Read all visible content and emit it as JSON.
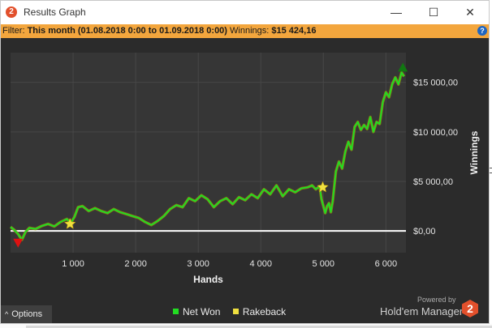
{
  "window": {
    "title": "Results Graph",
    "app_icon_glyph": "2",
    "controls": {
      "minimize": "—",
      "maximize": "☐",
      "close": "✕"
    }
  },
  "filter": {
    "label": "Filter:",
    "value": "This month (01.08.2018 0:00 to 01.09.2018 0:00)",
    "winnings_label": "Winnings:",
    "winnings_value": "$15 424,16",
    "help_icon": "?"
  },
  "options_button": {
    "caret": "^",
    "label": "Options"
  },
  "branding": {
    "powered_by": "Powered by",
    "name": "Hold'em Manager",
    "logo_glyph": "2"
  },
  "colors": {
    "net_won": "#22dd22",
    "rakeback": "#f0e040",
    "zero_line": "#ffffff",
    "filter_bar": "#f3a63d",
    "background": "#2b2b2b",
    "plot_background": "#363636",
    "gridline": "#474747",
    "min_marker": "#dd1111",
    "max_marker": "#117711"
  },
  "chart_data": {
    "type": "line",
    "xlabel": "Hands",
    "ylabel": "Winnings",
    "xlim": [
      0,
      6320
    ],
    "ylim": [
      -2200,
      18000
    ],
    "x_ticks": [
      1000,
      2000,
      3000,
      4000,
      5000,
      6000
    ],
    "x_tick_labels": [
      "1 000",
      "2 000",
      "3 000",
      "4 000",
      "5 000",
      "6 000"
    ],
    "y_ticks": [
      0,
      5000,
      10000,
      15000
    ],
    "y_tick_labels": [
      "$0,00",
      "$5 000,00",
      "$10 000,00",
      "$15 000,00"
    ],
    "grid": true,
    "legend": [
      "Net Won",
      "Rakeback"
    ],
    "legend_position": "bottom",
    "series": [
      {
        "name": "Net Won",
        "x": [
          0,
          60,
          120,
          180,
          240,
          300,
          400,
          500,
          600,
          700,
          800,
          900,
          960,
          1020,
          1080,
          1150,
          1250,
          1350,
          1450,
          1550,
          1650,
          1750,
          1850,
          1950,
          2050,
          2150,
          2250,
          2350,
          2450,
          2550,
          2650,
          2750,
          2850,
          2950,
          3050,
          3150,
          3250,
          3350,
          3450,
          3550,
          3650,
          3750,
          3850,
          3950,
          4050,
          4150,
          4250,
          4350,
          4450,
          4550,
          4650,
          4750,
          4820,
          4880,
          4940,
          4970,
          5000,
          5030,
          5060,
          5090,
          5120,
          5150,
          5200,
          5250,
          5300,
          5350,
          5400,
          5450,
          5500,
          5550,
          5600,
          5650,
          5700,
          5750,
          5800,
          5850,
          5900,
          5950,
          6000,
          6050,
          6100,
          6150,
          6200,
          6250,
          6290
        ],
        "y": [
          400,
          100,
          -300,
          -900,
          -100,
          300,
          200,
          500,
          700,
          450,
          900,
          1200,
          800,
          1400,
          2400,
          2500,
          2000,
          2300,
          2000,
          1800,
          2200,
          1900,
          1700,
          1500,
          1300,
          900,
          600,
          1000,
          1500,
          2200,
          2600,
          2400,
          3300,
          3000,
          3600,
          3200,
          2400,
          3000,
          3300,
          2700,
          3400,
          3100,
          3700,
          3300,
          4200,
          3700,
          4600,
          3500,
          4200,
          3900,
          4300,
          4400,
          4600,
          4200,
          4500,
          3200,
          2500,
          1800,
          2500,
          2800,
          1900,
          3000,
          6000,
          7000,
          6300,
          8000,
          9000,
          8200,
          10500,
          11000,
          10200,
          10700,
          10300,
          11500,
          10000,
          11000,
          10800,
          13000,
          14000,
          13500,
          14800,
          15500,
          14800,
          16000,
          15600
        ]
      }
    ],
    "rakeback_markers": [
      {
        "x": 950,
        "y": 700
      },
      {
        "x": 4990,
        "y": 4400
      }
    ],
    "min_marker": {
      "x": 120,
      "y": -1200
    },
    "max_marker": {
      "x": 6270,
      "y": 16500
    }
  }
}
